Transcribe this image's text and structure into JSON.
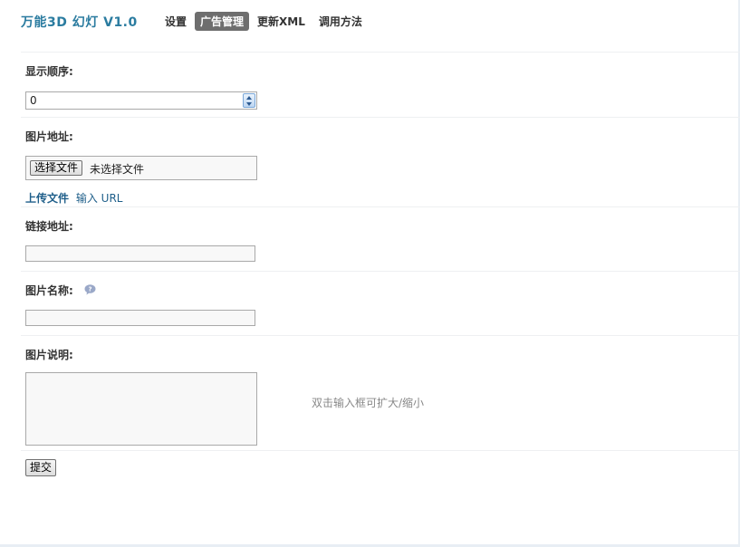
{
  "app": {
    "title": "万能3D 幻灯 V1.0"
  },
  "nav": {
    "items": [
      {
        "label": "设置"
      },
      {
        "label": "广告管理"
      },
      {
        "label": "更新XML"
      },
      {
        "label": "调用方法"
      }
    ],
    "active_index": 1
  },
  "form": {
    "order": {
      "label": "显示顺序:",
      "value": "0"
    },
    "image_url": {
      "label": "图片地址:",
      "file_button": "选择文件",
      "file_status": "未选择文件",
      "upload_link": "上传文件",
      "url_link": "输入 URL"
    },
    "link_url": {
      "label": "链接地址:",
      "value": ""
    },
    "image_name": {
      "label": "图片名称:",
      "value": "",
      "help_icon": "question-bubble-icon"
    },
    "image_desc": {
      "label": "图片说明:",
      "value": "",
      "hint": "双击输入框可扩大/缩小"
    },
    "submit_label": "提交"
  },
  "colors": {
    "title": "#2b7ca0",
    "active_tab": "#6e6e6e",
    "link": "#1f5f8a"
  }
}
